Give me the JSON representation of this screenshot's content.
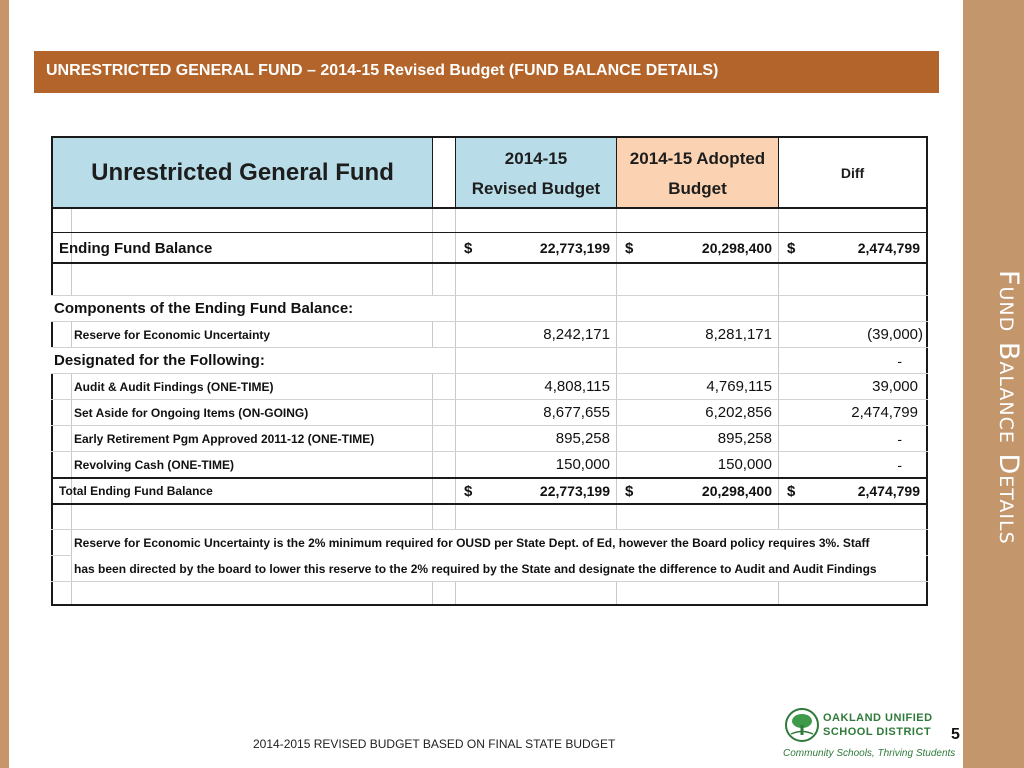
{
  "slide": {
    "banner_title": "UNRESTRICTED GENERAL FUND – 2014-15 Revised Budget (FUND BALANCE DETAILS)",
    "side_title": "Fund Balance Details",
    "footer_text": "2014-2015 REVISED BUDGET BASED ON FINAL STATE BUDGET",
    "page_number": "5"
  },
  "logo": {
    "line1": "OAKLAND UNIFIED",
    "line2": "SCHOOL DISTRICT",
    "tagline": "Community Schools, Thriving Students"
  },
  "table": {
    "header": {
      "label": "Unrestricted General Fund",
      "revised_line1": "2014-15",
      "revised_line2": "Revised Budget",
      "adopted_line1": "2014-15  Adopted",
      "adopted_line2": "Budget",
      "diff": "Diff"
    },
    "ending": {
      "label": "Ending Fund Balance",
      "revised": "22,773,199",
      "adopted": "20,298,400",
      "diff": "2,474,799",
      "currency": "$"
    },
    "components_heading": "Components of the Ending Fund Balance:",
    "reserve": {
      "label": "Reserve for Economic Uncertainty",
      "revised": "8,242,171",
      "adopted": "8,281,171",
      "diff": "(39,000)"
    },
    "designated_heading": "Designated for the Following:",
    "designated_diff": "-",
    "designated_items": [
      {
        "label": "Audit & Audit Findings (ONE-TIME)",
        "revised": "4,808,115",
        "adopted": "4,769,115",
        "diff": "39,000"
      },
      {
        "label": "Set Aside for Ongoing Items (ON-GOING)",
        "revised": "8,677,655",
        "adopted": "6,202,856",
        "diff": "2,474,799"
      },
      {
        "label": "Early Retirement Pgm Approved 2011-12 (ONE-TIME)",
        "revised": "895,258",
        "adopted": "895,258",
        "diff": "-"
      },
      {
        "label": "Revolving Cash (ONE-TIME)",
        "revised": "150,000",
        "adopted": "150,000",
        "diff": "-"
      }
    ],
    "total": {
      "label": "Total Ending Fund Balance",
      "revised": "22,773,199",
      "adopted": "20,298,400",
      "diff": "2,474,799",
      "currency": "$"
    },
    "note_line1": "Reserve for Economic Uncertainty is the 2% minimum required for OUSD per State Dept. of Ed, however the Board policy requires 3%. Staff",
    "note_line2": "has been directed by the board to lower this reserve to the 2% required by the State and designate the difference to Audit and Audit Findings"
  },
  "colors": {
    "banner": "#b2642a",
    "side_band": "#c4966c",
    "header_blue": "#b8dde9",
    "header_peach": "#fbd3b2",
    "logo_green": "#2f7a3a"
  }
}
